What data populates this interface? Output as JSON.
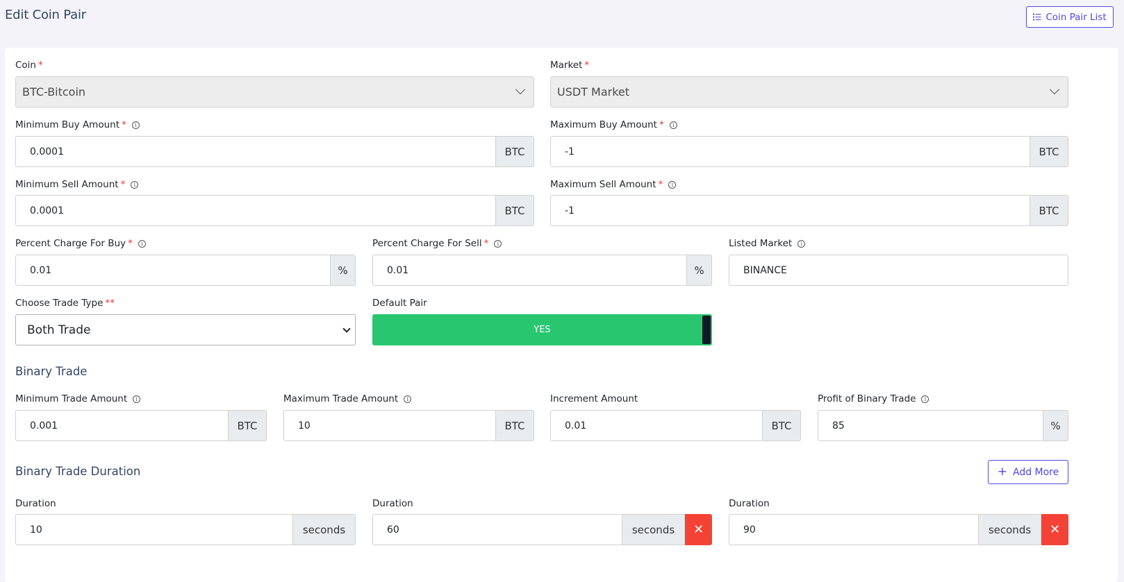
{
  "header": {
    "title": "Edit Coin Pair",
    "list_button_label": "Coin Pair List"
  },
  "form": {
    "coin": {
      "label": "Coin",
      "value": "BTC-Bitcoin"
    },
    "market": {
      "label": "Market",
      "value": "USDT Market"
    },
    "min_buy": {
      "label": "Minimum Buy Amount",
      "value": "0.0001",
      "unit": "BTC"
    },
    "max_buy": {
      "label": "Maximum Buy Amount",
      "value": "-1",
      "unit": "BTC"
    },
    "min_sell": {
      "label": "Minimum Sell Amount",
      "value": "0.0001",
      "unit": "BTC"
    },
    "max_sell": {
      "label": "Maximum Sell Amount",
      "value": "-1",
      "unit": "BTC"
    },
    "charge_buy": {
      "label": "Percent Charge For Buy",
      "value": "0.01",
      "unit": "%"
    },
    "charge_sell": {
      "label": "Percent Charge For Sell",
      "value": "0.01",
      "unit": "%"
    },
    "listed_market": {
      "label": "Listed Market",
      "value": "BINANCE"
    },
    "trade_type": {
      "label": "Choose Trade Type",
      "required_marks": "**",
      "value": "Both Trade"
    },
    "default_pair": {
      "label": "Default Pair",
      "value": "YES"
    }
  },
  "binary_trade": {
    "title": "Binary Trade",
    "min_trade": {
      "label": "Minimum Trade Amount",
      "value": "0.001",
      "unit": "BTC"
    },
    "max_trade": {
      "label": "Maximum Trade Amount",
      "value": "10",
      "unit": "BTC"
    },
    "increment": {
      "label": "Increment Amount",
      "value": "0.01",
      "unit": "BTC"
    },
    "profit": {
      "label": "Profit of Binary Trade",
      "value": "85",
      "unit": "%"
    }
  },
  "durations": {
    "title": "Binary Trade Duration",
    "add_more_label": "Add More",
    "items": [
      {
        "label": "Duration",
        "value": "10",
        "unit": "seconds"
      },
      {
        "label": "Duration",
        "value": "60",
        "unit": "seconds"
      },
      {
        "label": "Duration",
        "value": "90",
        "unit": "seconds"
      }
    ]
  },
  "colors": {
    "accent": "#4f46e5",
    "toggle_on": "#28c76f",
    "danger": "#f44336",
    "required": "#e53935"
  }
}
